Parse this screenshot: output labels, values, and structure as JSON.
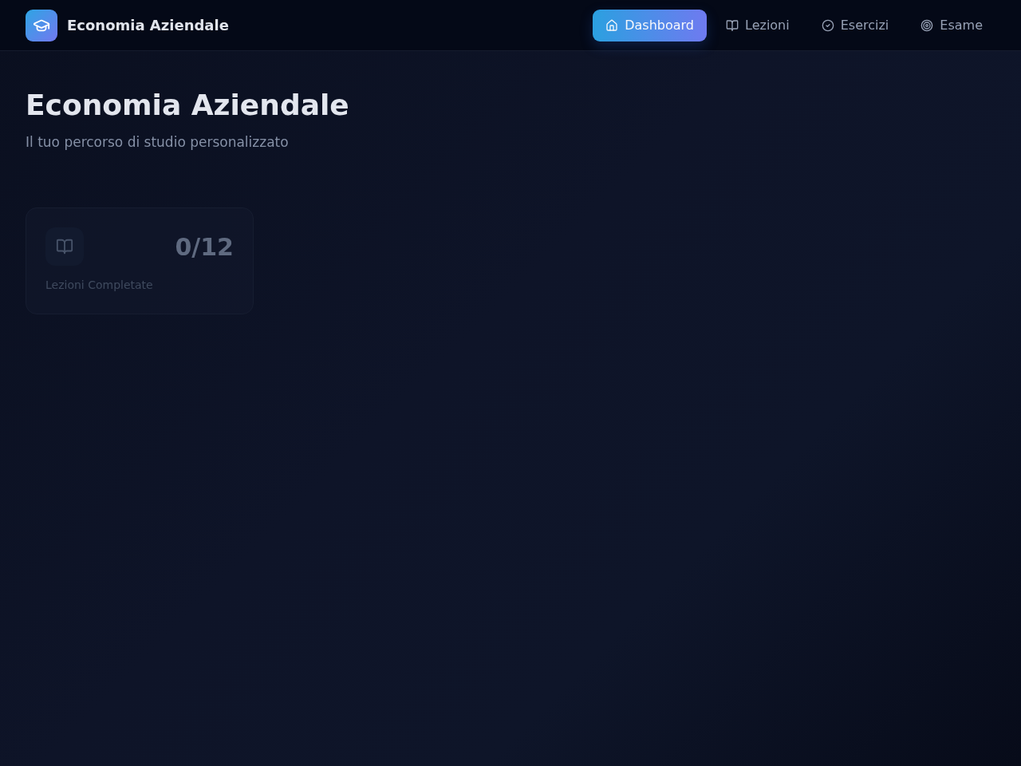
{
  "brand": {
    "title": "Economia Aziendale"
  },
  "nav": [
    {
      "label": "Dashboard",
      "selected": true
    },
    {
      "label": "Lezioni",
      "selected": false
    },
    {
      "label": "Esercizi",
      "selected": false
    },
    {
      "label": "Esame",
      "selected": false
    }
  ],
  "header": {
    "title": "Economia Aziendale",
    "subtitle": "Il tuo percorso di studio personalizzato"
  },
  "stats": [
    {
      "value": "0/12",
      "label": "Lezioni Completate"
    }
  ]
}
